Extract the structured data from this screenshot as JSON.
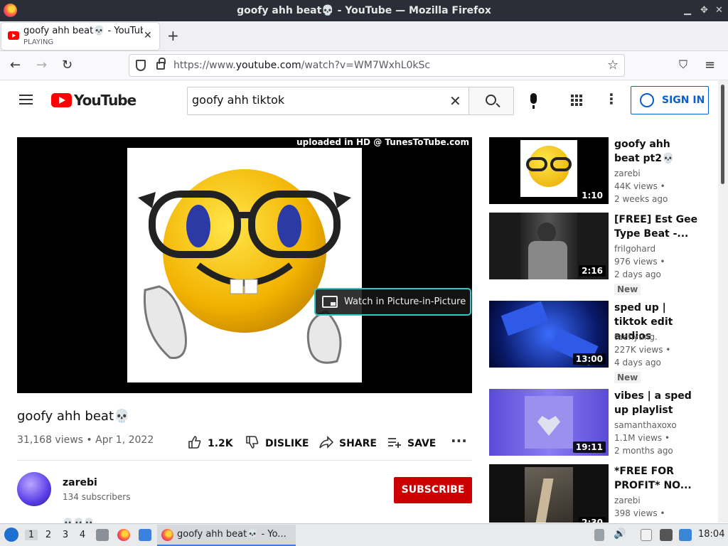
{
  "window": {
    "title": "goofy ahh beat💀 - YouTube — Mozilla Firefox",
    "minimize": "▁",
    "restore": "✥",
    "close": "✕"
  },
  "tab": {
    "title": "goofy ahh beat💀 - YouTube",
    "status": "PLAYING",
    "close": "✕",
    "new_tab": "+"
  },
  "nav": {
    "back": "←",
    "forward": "→",
    "reload": "↻",
    "url_prefix": "https://www.",
    "url_domain": "youtube.com",
    "url_rest": "/watch?v=WM7WxhL0kSc",
    "bookmark": "☆",
    "pocket": "⛉",
    "menu": "≡"
  },
  "yt": {
    "logo": "YouTube",
    "search_value": "goofy ahh tiktok",
    "clear": "✕",
    "more": "⋮",
    "signin": "SIGN IN"
  },
  "player": {
    "watermark": "uploaded in HD @ TunesToTube.com",
    "pip": "Watch in Picture-in-Picture"
  },
  "video": {
    "title": "goofy ahh beat💀",
    "meta": "31,168 views • Apr 1, 2022",
    "likes": "1.2K",
    "dislike": "DISLIKE",
    "share": "SHARE",
    "save": "SAVE",
    "more": "···",
    "channel": "zarebi",
    "subscribers": "134 subscribers",
    "subscribe": "SUBSCRIBE",
    "description": "💀💀💀"
  },
  "related": [
    {
      "title": "goofy ahh beat pt2💀",
      "channel": "zarebi",
      "views": "44K views •",
      "age": "2 weeks ago",
      "duration": "1:10",
      "badge": ""
    },
    {
      "title": "[FREE] Est Gee Type Beat -...",
      "channel": "frilgohard",
      "views": "976 views •",
      "age": "2 days ago",
      "duration": "2:16",
      "badge": "New"
    },
    {
      "title": "sped up | tiktok edit audios",
      "channel": "taehyung.",
      "views": "227K views •",
      "age": "4 days ago",
      "duration": "13:00",
      "badge": "New"
    },
    {
      "title": "vibes | a sped up playlist",
      "channel": "samanthaxoxo",
      "views": "1.1M views •",
      "age": "2 months ago",
      "duration": "19:11",
      "badge": ""
    },
    {
      "title": "*FREE FOR PROFIT* NO...",
      "channel": "zarebi",
      "views": "398 views •",
      "age": "",
      "duration": "2:30",
      "badge": ""
    }
  ],
  "taskbar": {
    "workspaces": [
      "1",
      "2",
      "3",
      "4"
    ],
    "task_label": "goofy ahh beat💀 - Yo...",
    "clock": "18:04"
  },
  "colors": {
    "yt_red": "#ff0000",
    "subscribe_red": "#cc0000",
    "link_blue": "#065fd4",
    "pip_border": "#33c7c5"
  }
}
